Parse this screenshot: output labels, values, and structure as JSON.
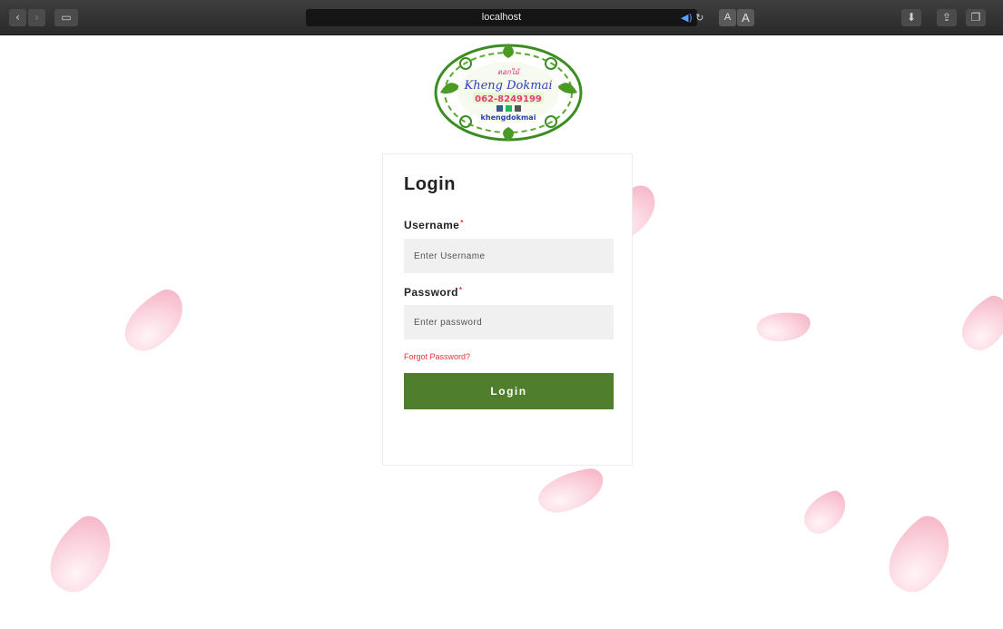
{
  "browser": {
    "url": "localhost",
    "reader_small": "A",
    "reader_large": "A",
    "back_glyph": "‹",
    "forward_glyph": "›",
    "sidebar_glyph": "▭",
    "download_glyph": "⬇",
    "share_glyph": "⇪",
    "tabs_glyph": "❐",
    "audio_glyph": "◀)",
    "reload_glyph": "↻"
  },
  "logo": {
    "top_text": "ดอกไม้",
    "brand": "Kheng Dokmai",
    "phone": "062-8249199",
    "handle": "khengdokmai"
  },
  "form": {
    "title": "Login",
    "username_label": "Username",
    "username_placeholder": "Enter Username",
    "password_label": "Password",
    "password_placeholder": "Enter password",
    "required_mark": "*",
    "forgot_label": "Forgot Password?",
    "submit_label": "Login"
  },
  "colors": {
    "accent_button": "#4f7f2c",
    "required": "#e5343a",
    "input_bg": "#f0f0f0",
    "petal": "#f3a8bb"
  }
}
